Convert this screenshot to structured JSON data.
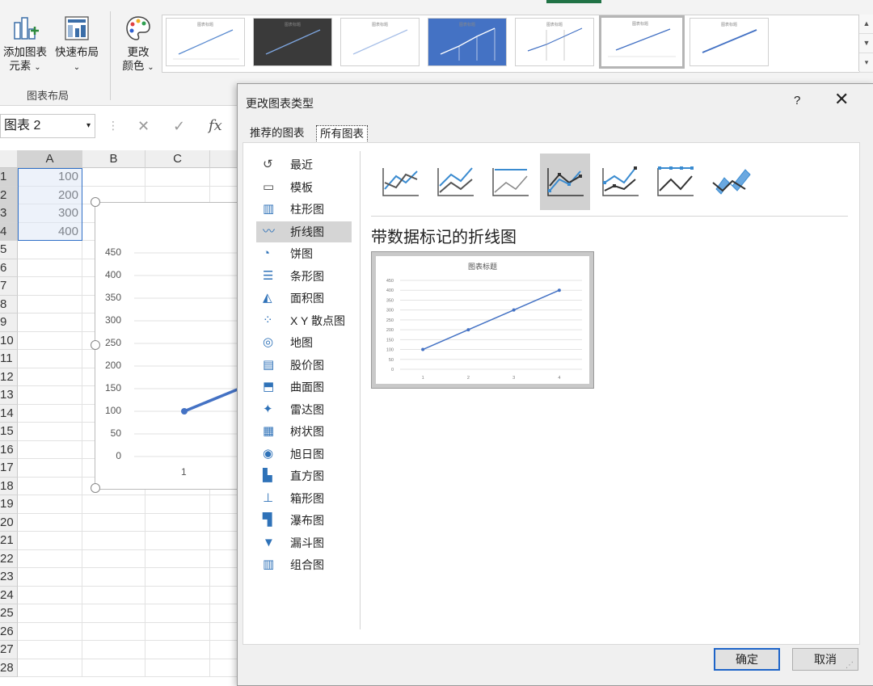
{
  "ribbon": {
    "add_element_label_1": "添加图表",
    "add_element_label_2": "元素",
    "quick_layout_label": "快速布局",
    "change_color_label_1": "更改",
    "change_color_label_2": "颜色",
    "group_label": "图表布局",
    "style_thumb_title": "图表标题"
  },
  "formula_bar": {
    "name_box": "图表 2",
    "cancel": "✕",
    "enter": "✓",
    "fx": "fx"
  },
  "sheet": {
    "columns": [
      "A",
      "B",
      "C"
    ],
    "rows": [
      "1",
      "2",
      "3",
      "4",
      "5",
      "6",
      "7",
      "8",
      "9",
      "10",
      "11",
      "12",
      "13",
      "14",
      "15",
      "16",
      "17",
      "18",
      "19",
      "20",
      "21",
      "22",
      "23",
      "24",
      "25",
      "26",
      "27",
      "28"
    ],
    "values": [
      "100",
      "200",
      "300",
      "400"
    ],
    "chart_y_ticks": [
      "450",
      "400",
      "350",
      "300",
      "250",
      "200",
      "150",
      "100",
      "50",
      "0"
    ],
    "chart_x_label": "1"
  },
  "dialog": {
    "title": "更改图表类型",
    "help": "?",
    "close": "✕",
    "tabs": [
      "推荐的图表",
      "所有图表"
    ],
    "categories": [
      "最近",
      "模板",
      "柱形图",
      "折线图",
      "饼图",
      "条形图",
      "面积图",
      "X Y 散点图",
      "地图",
      "股价图",
      "曲面图",
      "雷达图",
      "树状图",
      "旭日图",
      "直方图",
      "箱形图",
      "瀑布图",
      "漏斗图",
      "组合图"
    ],
    "selected_category": "折线图",
    "preview_heading": "带数据标记的折线图",
    "preview_chart_title": "图表标题",
    "ok": "确定",
    "cancel": "取消"
  },
  "chart_data": {
    "type": "line",
    "title": "图表标题",
    "categories": [
      "1",
      "2",
      "3",
      "4"
    ],
    "series": [
      {
        "values": [
          100,
          200,
          300,
          400
        ]
      }
    ],
    "ylim": [
      0,
      450
    ],
    "yticks": [
      0,
      50,
      100,
      150,
      200,
      250,
      300,
      350,
      400,
      450
    ],
    "markers": true,
    "grid": true,
    "color": "#4472c4"
  },
  "colors": {
    "accent": "#4472c4",
    "selection_fill": "#dce6f5",
    "ok_border": "#1e64c8"
  }
}
